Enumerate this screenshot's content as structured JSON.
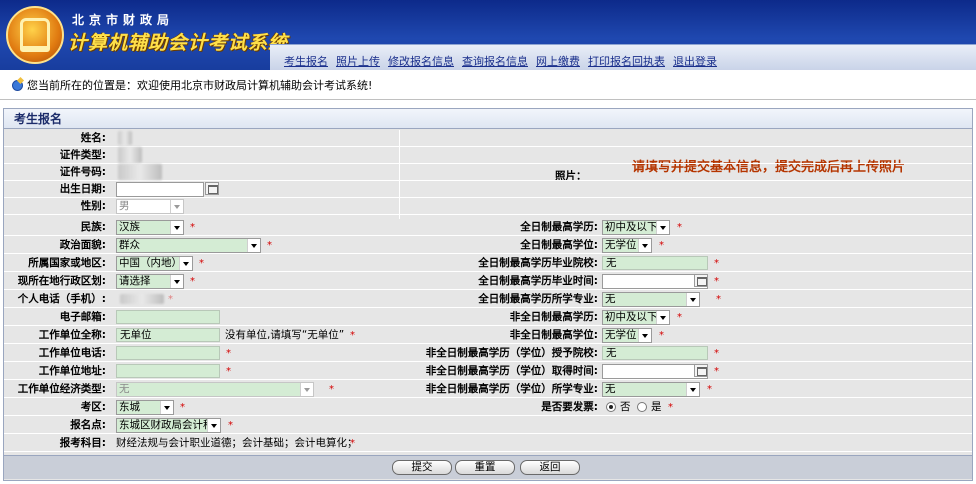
{
  "header": {
    "subtitle": "北京市财政局",
    "title": "计算机辅助会计考试系统",
    "nav": [
      "考生报名",
      "照片上传",
      "修改报名信息",
      "查询报名信息",
      "网上缴费",
      "打印报名回执表",
      "退出登录"
    ]
  },
  "location": {
    "text": "您当前所在的位置是：欢迎使用北京市财政局计算机辅助会计考试系统!"
  },
  "panel": {
    "title": "考生报名"
  },
  "left": {
    "name_label": "姓名:",
    "id_type_label": "证件类型:",
    "id_number_label": "证件号码:",
    "birth_label": "出生日期:",
    "gender_label": "性别:",
    "gender_value": "男",
    "ethnicity_label": "民族:",
    "ethnicity_value": "汉族",
    "political_label": "政治面貌:",
    "political_value": "群众",
    "country_label": "所属国家或地区:",
    "country_value": "中国（内地）",
    "district_label": "现所在地行政区划:",
    "district_value": "请选择",
    "phone_label": "个人电话（手机）:",
    "email_label": "电子邮箱:",
    "email_value": "",
    "employer_label": "工作单位全称:",
    "employer_value": "无单位",
    "employer_hint": "没有单位,请填写“无单位”",
    "work_phone_label": "工作单位电话:",
    "work_addr_label": "工作单位地址:",
    "econ_type_label": "工作单位经济类型:",
    "econ_type_value": "无",
    "exam_area_label": "考区:",
    "exam_area_value": "东城",
    "site_label": "报名点:",
    "site_value": "东城区财政局会计科",
    "subjects_label": "报考科目:",
    "subjects_value": "财经法规与会计职业道德；会计基础；会计电算化；"
  },
  "right": {
    "photo_label": "照片：",
    "photo_hint": "请填写并提交基本信息，提交完成后再上传照片",
    "ft_edu_label": "全日制最高学历:",
    "ft_edu_value": "初中及以下",
    "ft_degree_label": "全日制最高学位:",
    "ft_degree_value": "无学位",
    "ft_school_label": "全日制最高学历毕业院校:",
    "ft_school_value": "无",
    "ft_grad_time_label": "全日制最高学历毕业时间:",
    "ft_major_label": "全日制最高学历所学专业:",
    "ft_major_value": "无",
    "pt_edu_label": "非全日制最高学历:",
    "pt_edu_value": "初中及以下",
    "pt_degree_label": "非全日制最高学位:",
    "pt_degree_value": "无学位",
    "pt_school_label": "非全日制最高学历（学位）授予院校:",
    "pt_school_value": "无",
    "pt_time_label": "非全日制最高学历（学位）取得时间:",
    "pt_major_label": "非全日制最高学历（学位）所学专业:",
    "pt_major_value": "无",
    "invoice_label": "是否要发票:",
    "invoice_no": "否",
    "invoice_yes": "是"
  },
  "buttons": {
    "submit": "提交",
    "reset": "重置",
    "back": "返回"
  },
  "required_mark": "*"
}
